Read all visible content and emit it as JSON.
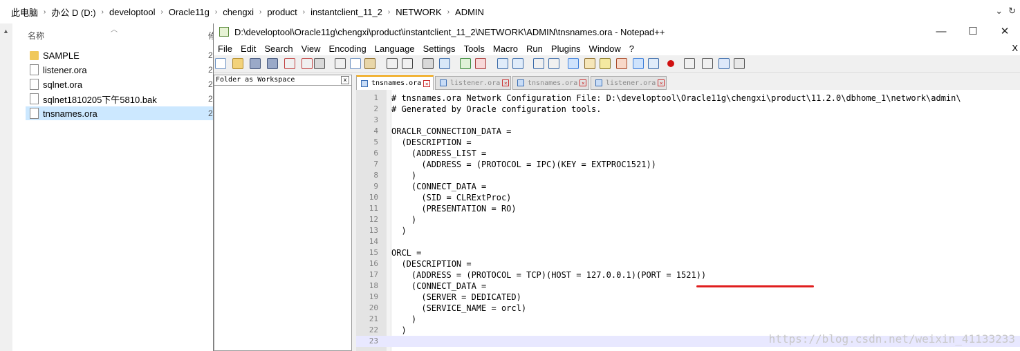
{
  "explorer": {
    "breadcrumb": [
      "此电脑",
      "办公 D (D:)",
      "developtool",
      "Oracle11g",
      "chengxi",
      "product",
      "instantclient_11_2",
      "NETWORK",
      "ADMIN"
    ],
    "column_name": "名称",
    "column_date_clip": "修",
    "files": [
      {
        "name": "SAMPLE",
        "type": "folder",
        "date_clip": "2"
      },
      {
        "name": "listener.ora",
        "type": "file",
        "date_clip": "2"
      },
      {
        "name": "sqlnet.ora",
        "type": "file",
        "date_clip": "2"
      },
      {
        "name": "sqlnet1810205下午5810.bak",
        "type": "file",
        "date_clip": "2"
      },
      {
        "name": "tnsnames.ora",
        "type": "file",
        "date_clip": "2",
        "selected": true
      }
    ]
  },
  "npp": {
    "title": "D:\\developtool\\Oracle11g\\chengxi\\product\\instantclient_11_2\\NETWORK\\ADMIN\\tnsnames.ora - Notepad++",
    "window_buttons": {
      "minimize": "—",
      "maximize": "☐",
      "close": "✕"
    },
    "menu": [
      "File",
      "Edit",
      "Search",
      "View",
      "Encoding",
      "Language",
      "Settings",
      "Tools",
      "Macro",
      "Run",
      "Plugins",
      "Window",
      "?"
    ],
    "menu_close": "X",
    "workspace_title": "Folder as Workspace",
    "workspace_close": "x",
    "tabs": [
      {
        "label": "tnsnames.ora",
        "active": true
      },
      {
        "label": "listener.ora",
        "active": false
      },
      {
        "label": "tnsnames.ora",
        "active": false
      },
      {
        "label": "listener.ora",
        "active": false
      }
    ],
    "lines": [
      "# tnsnames.ora Network Configuration File: D:\\developtool\\Oracle11g\\chengxi\\product\\11.2.0\\dbhome_1\\network\\admin\\",
      "# Generated by Oracle configuration tools.",
      "",
      "ORACLR_CONNECTION_DATA =",
      "  (DESCRIPTION =",
      "    (ADDRESS_LIST =",
      "      (ADDRESS = (PROTOCOL = IPC)(KEY = EXTPROC1521))",
      "    )",
      "    (CONNECT_DATA =",
      "      (SID = CLRExtProc)",
      "      (PRESENTATION = RO)",
      "    )",
      "  )",
      "",
      "ORCL =",
      "  (DESCRIPTION =",
      "    (ADDRESS = (PROTOCOL = TCP)(HOST = 127.0.0.1)(PORT = 1521))",
      "    (CONNECT_DATA =",
      "      (SERVER = DEDICATED)",
      "      (SERVICE_NAME = orcl)",
      "    )",
      "  )",
      ""
    ],
    "current_line": 23,
    "watermark": "https://blog.csdn.net/weixin_41133233",
    "colors": {
      "accent_tab": "#f0a000",
      "annotation": "#e01e1e",
      "caret": "#8000ff"
    }
  }
}
